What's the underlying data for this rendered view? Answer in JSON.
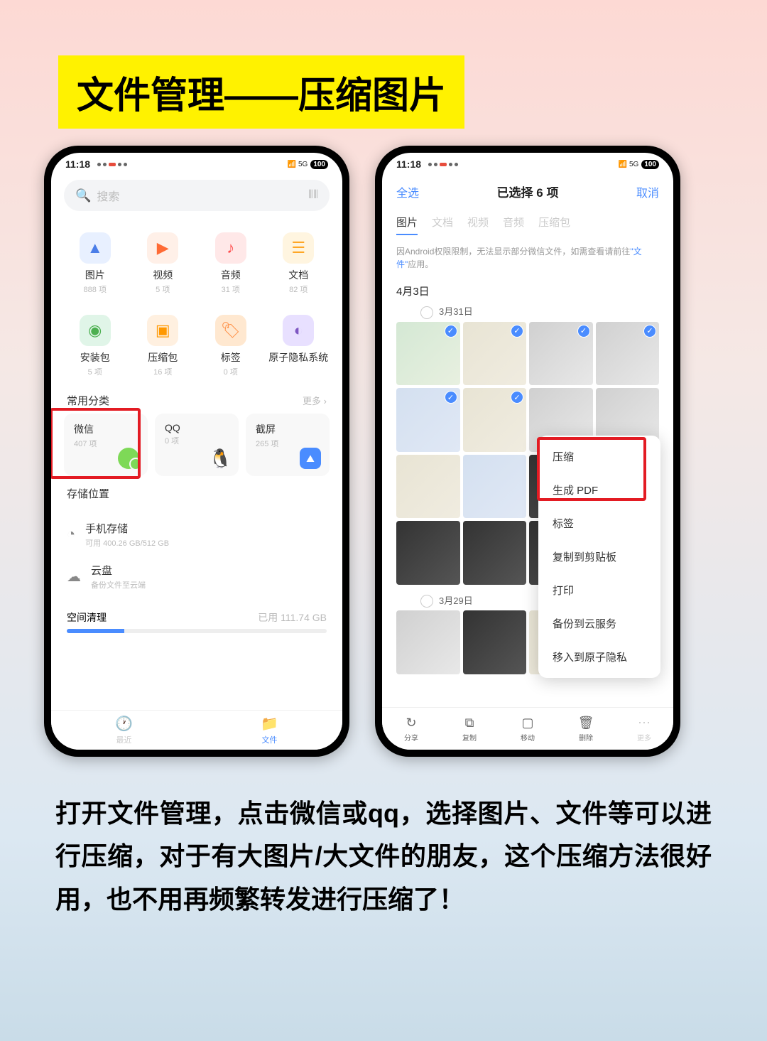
{
  "banner": "文件管理——压缩图片",
  "statusbar": {
    "time": "11:18",
    "battery": "100"
  },
  "left": {
    "search_placeholder": "搜索",
    "categories": [
      {
        "label": "图片",
        "count": "888 项"
      },
      {
        "label": "视频",
        "count": "5 项"
      },
      {
        "label": "音频",
        "count": "31 项"
      },
      {
        "label": "文档",
        "count": "82 项"
      },
      {
        "label": "安装包",
        "count": "5 项"
      },
      {
        "label": "压缩包",
        "count": "16 项"
      },
      {
        "label": "标签",
        "count": "0 项"
      },
      {
        "label": "原子隐私系统",
        "count": ""
      }
    ],
    "common_section": "常用分类",
    "more": "更多",
    "apps": [
      {
        "name": "微信",
        "count": "407 项"
      },
      {
        "name": "QQ",
        "count": "0 项"
      },
      {
        "name": "截屏",
        "count": "265 项"
      }
    ],
    "storage_title": "存储位置",
    "phone_storage": {
      "title": "手机存储",
      "detail": "可用 400.26 GB/512 GB"
    },
    "cloud": {
      "title": "云盘",
      "detail": "备份文件至云端"
    },
    "clean": {
      "label": "空间清理",
      "used": "已用 111.74 GB"
    },
    "nav": {
      "recent": "最近",
      "files": "文件"
    }
  },
  "right": {
    "select_all": "全选",
    "title": "已选择 6 项",
    "cancel": "取消",
    "tabs": [
      "图片",
      "文档",
      "视频",
      "音频",
      "压缩包"
    ],
    "notice_pre": "因Android权限限制，无法显示部分微信文件，如需查看请前往",
    "notice_link": "\"文件\"",
    "notice_post": "应用。",
    "date1": "4月3日",
    "date1b": "3月31日",
    "date2": "3月29日",
    "menu": [
      "压缩",
      "生成 PDF",
      "标签",
      "复制到剪贴板",
      "打印",
      "备份到云服务",
      "移入到原子隐私"
    ],
    "actions": [
      "分享",
      "复制",
      "移动",
      "删除",
      "更多"
    ]
  },
  "instructions": "打开文件管理，点击微信或qq，选择图片、文件等可以进行压缩，对于有大图片/大文件的朋友，这个压缩方法很好用，也不用再频繁转发进行压缩了！"
}
